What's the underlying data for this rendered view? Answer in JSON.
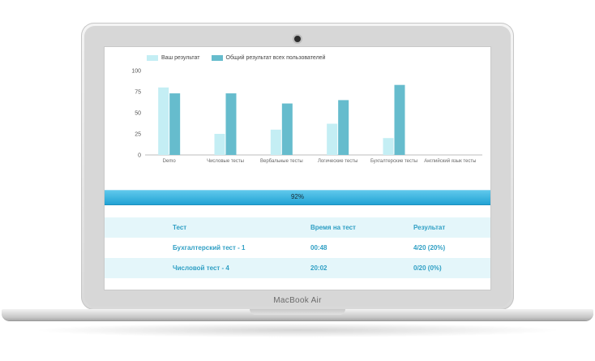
{
  "device": {
    "brand_label": "MacBook Air"
  },
  "legend": {
    "yours": {
      "label": "Ваш результат",
      "color": "#c4eef4"
    },
    "all": {
      "label": "Общий результат всех пользователей",
      "color": "#66bccd"
    }
  },
  "chart_data": {
    "type": "bar",
    "categories": [
      "Demo",
      "Числовые тесты",
      "Вербальные тесты",
      "Логические тесты",
      "Бухгалтерские тесты",
      "Английский язык тесты"
    ],
    "series": [
      {
        "name": "Ваш результат",
        "color": "#c4eef4",
        "values": [
          80,
          25,
          30,
          37,
          20,
          0
        ]
      },
      {
        "name": "Общий результат всех пользователей",
        "color": "#66bccd",
        "values": [
          73,
          73,
          61,
          65,
          83,
          0
        ]
      }
    ],
    "yticks": [
      0,
      25,
      50,
      75,
      100
    ],
    "ylim": [
      0,
      100
    ],
    "grid": false,
    "legend_position": "top-left"
  },
  "progress": {
    "value": 92,
    "label": "92%"
  },
  "results": {
    "headers": [
      "Тест",
      "Время на тест",
      "Результат"
    ],
    "rows": [
      [
        "Бухгалтерский тест - 1",
        "00:48",
        "4/20 (20%)"
      ],
      [
        "Числовой тест - 4",
        "20:02",
        "0/20 (0%)"
      ]
    ]
  }
}
